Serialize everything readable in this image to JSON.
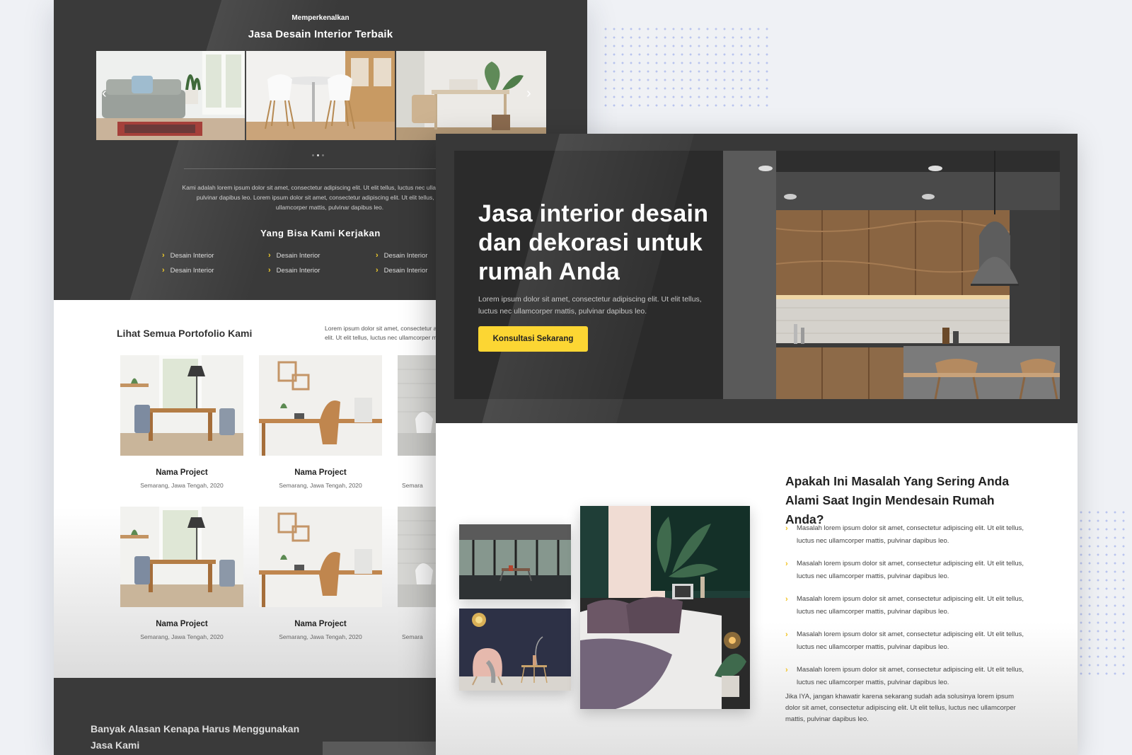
{
  "back": {
    "intro": {
      "kicker": "Memperkenalkan",
      "title": "Jasa Desain Interior Terbaik",
      "paragraph": "Kami adalah lorem ipsum dolor sit amet, consectetur adipiscing elit. Ut elit tellus, luctus nec ullamcorper mattis, pulvinar dapibus leo. Lorem ipsum dolor sit amet, consectetur adipiscing elit. Ut elit tellus, luctus nec ullamcorper mattis, pulvinar dapibus leo."
    },
    "slider": {
      "prev": "‹",
      "next": "›",
      "dots": 3,
      "active_dot": 1
    },
    "services": {
      "title": "Yang Bisa Kami Kerjakan",
      "items": [
        "Desain Interior",
        "Desain Interior",
        "Desain Interior",
        "Desain Interior",
        "Desain Interior",
        "Desain Interior"
      ]
    },
    "portfolio": {
      "title": "Lihat Semua Portofolio Kami",
      "paragraph": "Lorem ipsum dolor sit amet, consectetur adipiscing elit. Ut elit tellus, luctus nec ullamcorper mattis,",
      "projects": [
        {
          "name": "Nama Project",
          "meta": "Semarang, Jawa Tengah, 2020"
        },
        {
          "name": "Nama Project",
          "meta": "Semarang, Jawa Tengah, 2020"
        },
        {
          "name": "",
          "meta": "Semara"
        },
        {
          "name": "Nama Project",
          "meta": "Semarang, Jawa Tengah, 2020"
        },
        {
          "name": "Nama Project",
          "meta": "Semarang, Jawa Tengah, 2020"
        },
        {
          "name": "",
          "meta": "Semara"
        }
      ]
    },
    "reasons": {
      "title": "Banyak Alasan Kenapa Harus Menggunakan Jasa Kami"
    }
  },
  "front": {
    "hero": {
      "title": "Jasa interior desain dan dekorasi untuk rumah Anda",
      "paragraph": "Lorem ipsum dolor sit amet, consectetur adipiscing elit. Ut elit tellus, luctus nec ullamcorper mattis, pulvinar dapibus leo.",
      "cta": "Konsultasi Sekarang"
    },
    "problems": {
      "title": "Apakah Ini Masalah Yang Sering Anda Alami Saat Ingin Mendesain Rumah Anda?",
      "items": [
        "Masalah lorem ipsum dolor sit amet, consectetur adipiscing elit. Ut elit tellus, luctus nec ullamcorper mattis, pulvinar dapibus leo.",
        "Masalah lorem ipsum dolor sit amet, consectetur adipiscing elit. Ut elit tellus, luctus nec ullamcorper mattis, pulvinar dapibus leo.",
        "Masalah lorem ipsum dolor sit amet, consectetur adipiscing elit. Ut elit tellus, luctus nec ullamcorper mattis, pulvinar dapibus leo.",
        "Masalah lorem ipsum dolor sit amet, consectetur adipiscing elit. Ut elit tellus, luctus nec ullamcorper mattis, pulvinar dapibus leo.",
        "Masalah lorem ipsum dolor sit amet, consectetur adipiscing elit. Ut elit tellus, luctus nec ullamcorper mattis, pulvinar dapibus leo."
      ],
      "closing": "Jika IYA, jangan khawatir karena sekarang sudah ada solusinya lorem ipsum dolor sit amet, consectetur adipiscing elit. Ut elit tellus, luctus nec ullamcorper mattis, pulvinar dapibus leo."
    }
  },
  "colors": {
    "accent": "#fcd633",
    "dark": "#3a3a3a",
    "chevron": "#f2c21c"
  },
  "icons": {
    "chevron": "chevron-right-icon",
    "arrow_left": "arrow-left-icon",
    "arrow_right": "arrow-right-icon"
  }
}
